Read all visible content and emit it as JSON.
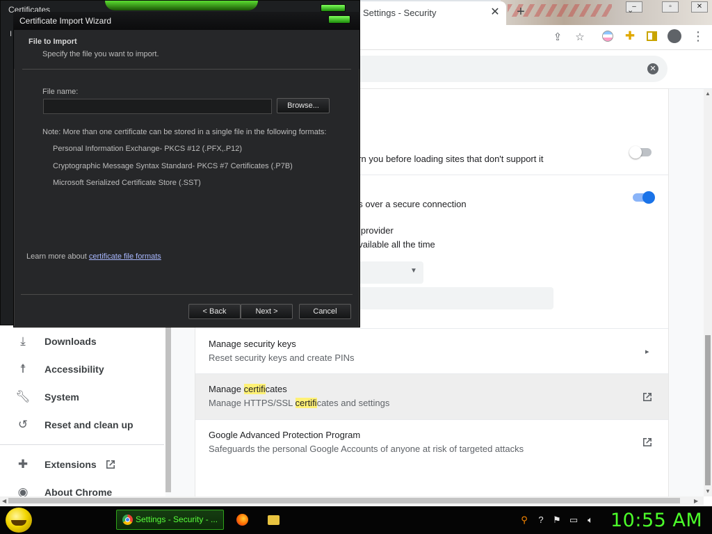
{
  "browser": {
    "tab_title": "Settings - Security",
    "tab_close": "✕",
    "new_tab": "+",
    "search_clear": "✕"
  },
  "settings_rows": {
    "safe_browsing_fragment": "arn you before loading sites that don't support it",
    "secure_dns_fragment": "es over a secure connection",
    "provider_title_fragment": "e provider",
    "provider_sub_fragment": "available all the time",
    "security_keys_title": "Manage security keys",
    "security_keys_sub": "Reset security keys and create PINs",
    "certs_title_pre": "Manage ",
    "certs_title_hl": "certifi",
    "certs_title_post": "cates",
    "certs_sub_pre": "Manage HTTPS/SSL ",
    "certs_sub_hl": "certifi",
    "certs_sub_post": "cates and settings",
    "gapp_title": "Google Advanced Protection Program",
    "gapp_sub": "Safeguards the personal Google Accounts of anyone at risk of targeted attacks",
    "toggle_https_first": false,
    "toggle_secure_dns": true
  },
  "left_nav": [
    {
      "label": "Downloads",
      "icon": "download-icon"
    },
    {
      "label": "Accessibility",
      "icon": "accessibility-icon"
    },
    {
      "label": "System",
      "icon": "wrench-icon"
    },
    {
      "label": "Reset and clean up",
      "icon": "history-icon"
    },
    {
      "label": "Extensions",
      "icon": "puzzle-icon"
    },
    {
      "label": "About Chrome",
      "icon": "chrome-icon"
    }
  ],
  "certificates_window": {
    "title": "Certificates",
    "frag": "I"
  },
  "wizard": {
    "title": "Certificate Import Wizard",
    "header_title": "File to Import",
    "header_sub": "Specify the file you want to import.",
    "file_label": "File name:",
    "file_value": "",
    "browse": "Browse...",
    "note": "Note:  More than one certificate can be stored in a single file in the following formats:",
    "formats": [
      "Personal Information Exchange- PKCS #12 (.PFX,.P12)",
      "Cryptographic Message Syntax Standard- PKCS #7 Certificates (.P7B)",
      "Microsoft Serialized Certificate Store (.SST)"
    ],
    "learn_more": "Learn more about ",
    "learn_link": "certificate file formats",
    "back": "< Back",
    "next": "Next >",
    "cancel": "Cancel"
  },
  "taskbar": {
    "chrome_task": "Settings - Security - ...",
    "clock": "10:55 AM"
  },
  "colors": {
    "accent": "#1a73e8",
    "highlight": "#fff176",
    "taskbar_green": "#4cff2a"
  }
}
